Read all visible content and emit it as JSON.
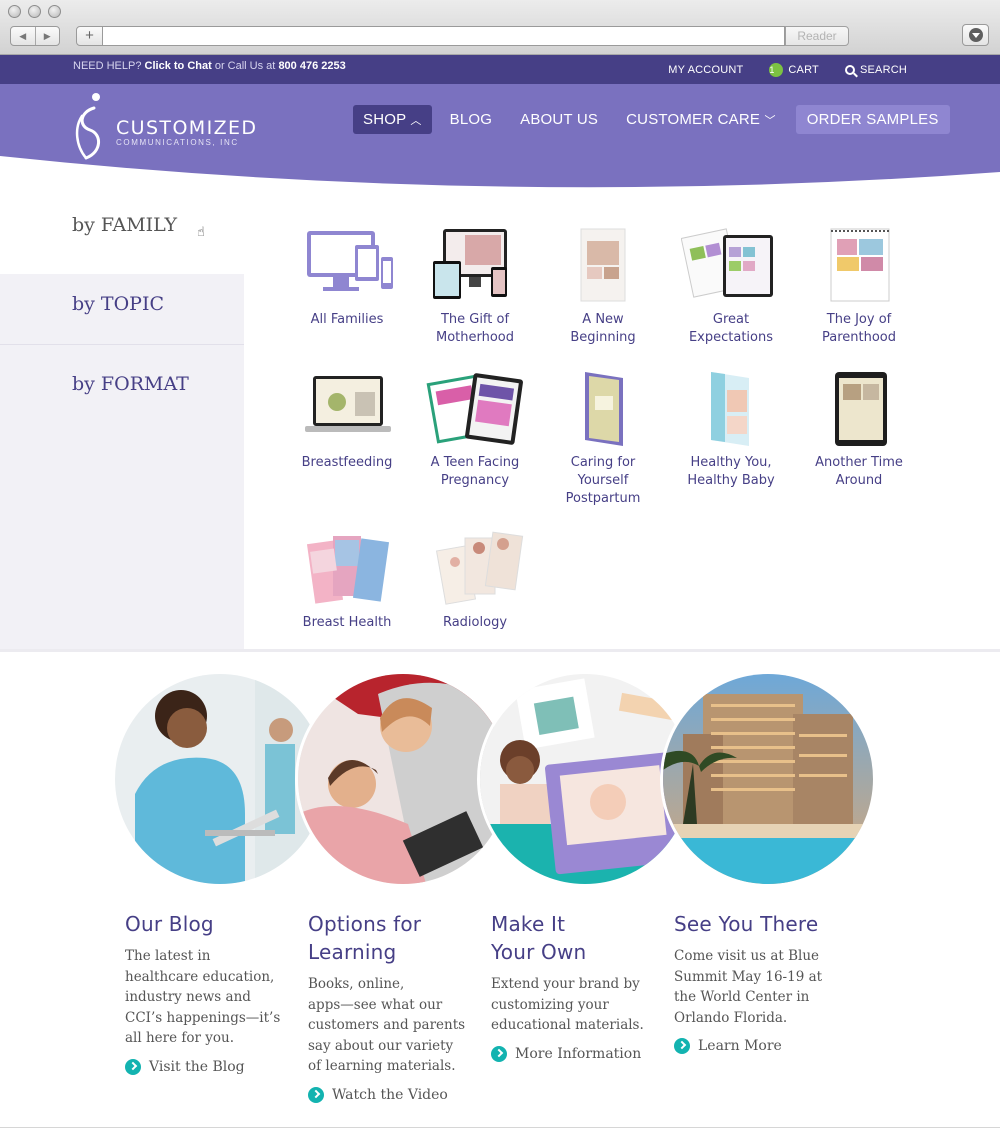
{
  "browser": {
    "reader_label": "Reader",
    "back_glyph": "◀",
    "forward_glyph": "▶",
    "plus_glyph": "+"
  },
  "utility": {
    "help_prefix": "NEED HELP?",
    "chat_link": "Click to Chat",
    "or_call": "or Call Us at",
    "phone": "800 476 2253",
    "my_account": "MY ACCOUNT",
    "cart_count": "1",
    "cart": "CART",
    "search": "SEARCH"
  },
  "logo": {
    "line1": "CUSTOMIZED",
    "line2": "COMMUNICATIONS, INC"
  },
  "nav": {
    "shop": "SHOP",
    "blog": "BLOG",
    "about": "ABOUT US",
    "care": "CUSTOMER CARE",
    "samples": "ORDER SAMPLES"
  },
  "sidebar": {
    "items": [
      {
        "label": "by FAMILY"
      },
      {
        "label": "by TOPIC"
      },
      {
        "label": "by FORMAT"
      }
    ]
  },
  "products": [
    {
      "line1": "All Families",
      "line2": ""
    },
    {
      "line1": "The Gift of",
      "line2": "Motherhood"
    },
    {
      "line1": "A New",
      "line2": "Beginning"
    },
    {
      "line1": "Great",
      "line2": "Expectations"
    },
    {
      "line1": "The Joy of",
      "line2": "Parenthood"
    },
    {
      "line1": "Breastfeeding",
      "line2": ""
    },
    {
      "line1": "A Teen Facing",
      "line2": "Pregnancy"
    },
    {
      "line1": "Caring for",
      "line2": "Yourself",
      "line3": "Postpartum"
    },
    {
      "line1": "Healthy You,",
      "line2": "Healthy Baby"
    },
    {
      "line1": "Another Time",
      "line2": "Around"
    },
    {
      "line1": "Breast Health",
      "line2": ""
    },
    {
      "line1": "Radiology",
      "line2": ""
    }
  ],
  "features": [
    {
      "title1": "Our Blog",
      "title2": "",
      "lines": [
        "The latest in",
        "healthcare education,",
        "industry news and",
        "CCI’s happenings—it’s",
        "all here for you."
      ],
      "link": "Visit the Blog"
    },
    {
      "title1": "Options for",
      "title2": "Learning",
      "lines": [
        "Books, online,",
        "apps—see what our",
        "customers and parents",
        "say about our variety",
        "of learning materials."
      ],
      "link": "Watch the Video"
    },
    {
      "title1": "Make It",
      "title2": "Your Own",
      "lines": [
        "Extend your brand by",
        "customizing your",
        "educational materials."
      ],
      "link": "More Information"
    },
    {
      "title1": "See You There",
      "title2": "",
      "lines": [
        "Come visit us at Blue",
        "Summit May 16-19 at",
        "the World Center in",
        "Orlando Florida."
      ],
      "link": "Learn More"
    }
  ],
  "colors": {
    "brand_purple": "#463f86",
    "header_purple": "#7a71bf",
    "accent_teal": "#13b3b0"
  }
}
